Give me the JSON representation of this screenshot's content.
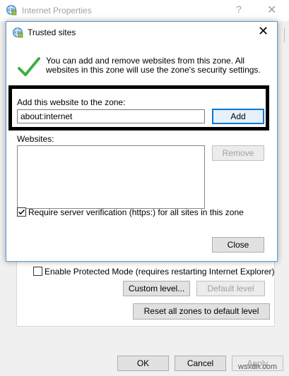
{
  "background_window": {
    "title": "Internet Properties",
    "help_icon": "?",
    "close_icon": "✕",
    "protected_mode_label": "Enable Protected Mode (requires restarting Internet Explorer)",
    "protected_mode_checked": false,
    "custom_level_label": "Custom level...",
    "default_level_label": "Default level",
    "reset_zones_label": "Reset all zones to default level",
    "ok_label": "OK",
    "cancel_label": "Cancel",
    "apply_label": "Apply"
  },
  "dialog": {
    "title": "Trusted sites",
    "close_icon": "✕",
    "info_text": "You can add and remove websites from this zone. All websites in this zone will use the zone's security settings.",
    "add_label": "Add this website to the zone:",
    "site_input_value": "about:internet",
    "add_button": "Add",
    "websites_label": "Websites:",
    "websites": [],
    "remove_button": "Remove",
    "verify_label": "Require server verification (https:) for all sites in this zone",
    "verify_checked": true,
    "close_button": "Close"
  },
  "watermark": "wsxdn.com",
  "colors": {
    "accent": "#0078d7",
    "highlight_border": "#000000",
    "check_green": "#3cb043"
  }
}
